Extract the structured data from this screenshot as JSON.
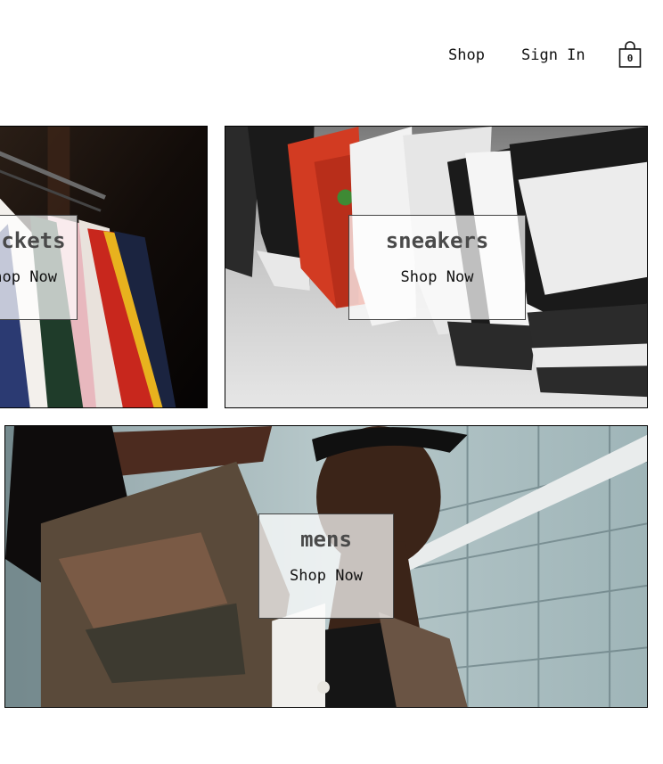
{
  "nav": {
    "shop_label": "Shop",
    "signin_label": "Sign In",
    "cart_count": "0"
  },
  "tiles": [
    {
      "title": "jackets",
      "subtitle": "Shop Now",
      "image": "jackets-rack-photo"
    },
    {
      "title": "sneakers",
      "subtitle": "Shop Now",
      "image": "sneakers-row-photo"
    },
    {
      "title": "mens",
      "subtitle": "Shop Now",
      "image": "mens-model-photo"
    }
  ],
  "colors": {
    "text": "#111111",
    "title_text": "#4a4a4a",
    "overlay_bg": "rgba(255,255,255,0.72)",
    "border": "#000000"
  }
}
